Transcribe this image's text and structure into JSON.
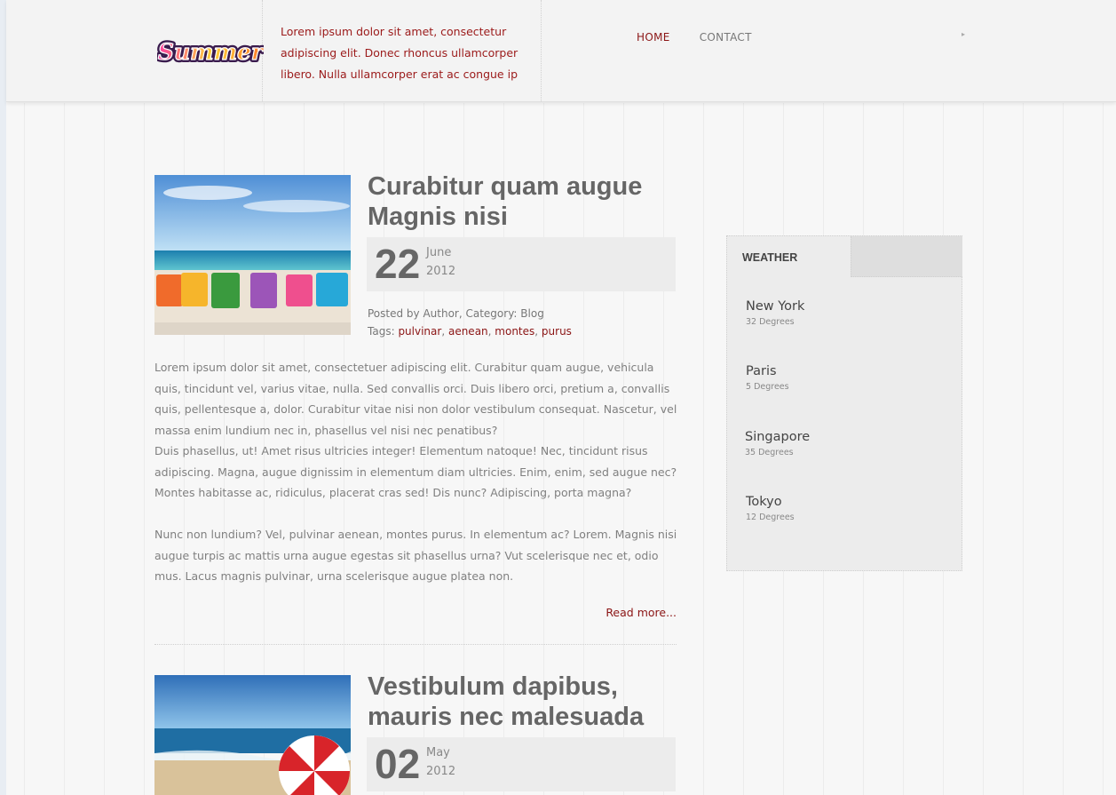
{
  "header": {
    "logo_text": "Summer",
    "tagline": "Lorem ipsum dolor sit amet, consectetur adipiscing elit. Donec rhoncus ullamcorper libero. Nulla ullamcorper erat ac congue  ip",
    "nav": [
      {
        "label": "HOME",
        "active": true
      },
      {
        "label": "CONTACT",
        "active": false
      }
    ],
    "nav_arrow": "▸"
  },
  "posts": [
    {
      "title_line1": "Curabitur quam augue",
      "title_line2": "Magnis nisi",
      "day": "22",
      "month": "June",
      "year": "2012",
      "meta_prefix": "Posted by Author, Category: Blog",
      "tags_label": "Tags: ",
      "tags": [
        "pulvinar",
        "aenean",
        "montes",
        "purus"
      ],
      "para1": "Lorem ipsum dolor sit amet, consectetuer adipiscing elit. Curabitur quam augue, vehicula quis, tincidunt vel, varius vitae, nulla. Sed convallis orci. Duis libero orci, pretium a, convallis quis, pellentesque a, dolor. Curabitur vitae nisi non dolor vestibulum consequat. Nascetur, vel massa enim lundium nec in, phasellus vel nisi nec penatibus?",
      "para2": "Duis phasellus, ut! Amet risus ultricies integer! Elementum natoque! Nec, tincidunt risus adipiscing. Magna, augue dignissim in elementum diam ultricies. Enim, enim, sed augue nec? Montes habitasse ac, ridiculus, placerat cras sed! Dis nunc? Adipiscing, porta magna?",
      "para3": "Nunc non lundium? Vel, pulvinar aenean, montes purus. In elementum ac? Lorem. Magnis nisi augue turpis ac mattis urna augue egestas sit phasellus urna? Vut scelerisque nec et, odio mus. Lacus magnis pulvinar, urna scelerisque augue platea non.",
      "read_more": "Read more..."
    },
    {
      "title_line1": "Vestibulum dapibus,",
      "title_line2": "mauris nec malesuada",
      "day": "02",
      "month": "May",
      "year": "2012"
    }
  ],
  "weather": {
    "title": "WEATHER",
    "cities": [
      {
        "name": "New York",
        "degrees": "32 Degrees"
      },
      {
        "name": "Paris",
        "degrees": "5 Degrees"
      },
      {
        "name": "Singapore",
        "degrees": "35 Degrees"
      },
      {
        "name": "Tokyo",
        "degrees": "12 Degrees"
      }
    ]
  },
  "colors": {
    "accent": "#8b1515",
    "heading": "#666666",
    "body_text": "#808080"
  }
}
